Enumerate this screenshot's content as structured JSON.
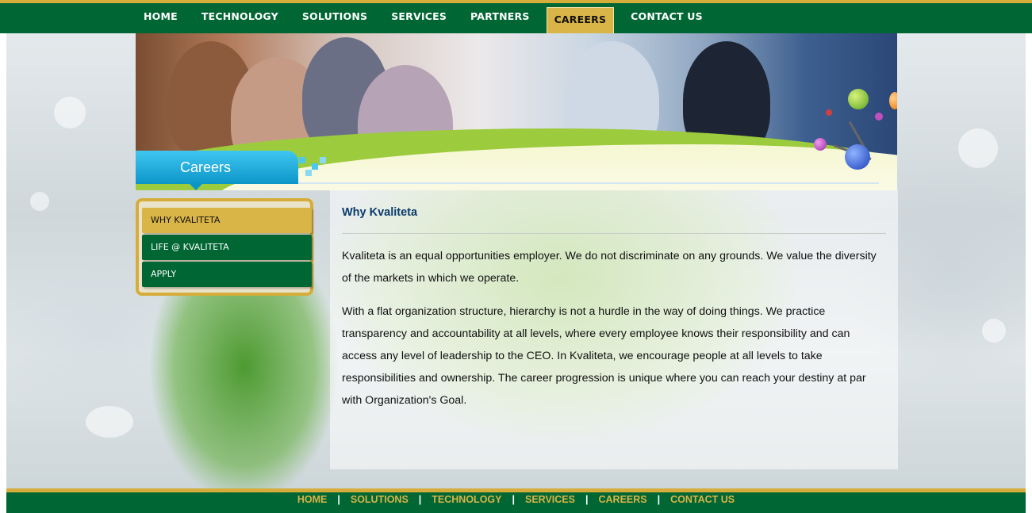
{
  "top_nav": {
    "items": [
      {
        "label": "HOME"
      },
      {
        "label": "TECHNOLOGY"
      },
      {
        "label": "SOLUTIONS"
      },
      {
        "label": "SERVICES"
      },
      {
        "label": "PARTNERS"
      },
      {
        "label": "CAREERS",
        "active": true
      },
      {
        "label": "CONTACT US"
      }
    ]
  },
  "banner": {
    "section_title": "Careers"
  },
  "sidebar": {
    "items": [
      {
        "label": "WHY KVALITETA",
        "active": true
      },
      {
        "label": "LIFE @ KVALITETA"
      },
      {
        "label": "APPLY"
      }
    ]
  },
  "content": {
    "heading": "Why Kvaliteta",
    "paragraphs": [
      "Kvaliteta is an equal opportunities employer. We do not discriminate on any grounds. We value the diversity of the markets in which we operate.",
      "With a flat organization structure, hierarchy is not a hurdle in the way of doing things. We practice transparency and accountability at all levels, where every employee knows their responsibility and can access any level of leadership to the CEO. In Kvaliteta, we encourage people at all levels to take responsibilities and ownership. The career progression is unique where you can reach your destiny at par with Organization's Goal."
    ]
  },
  "footer_nav": {
    "items": [
      {
        "label": "HOME"
      },
      {
        "label": "SOLUTIONS"
      },
      {
        "label": "TECHNOLOGY"
      },
      {
        "label": "SERVICES"
      },
      {
        "label": "CAREERS"
      },
      {
        "label": "CONTACT US"
      }
    ],
    "separator": "|"
  },
  "colors": {
    "brand_green": "#006633",
    "brand_gold": "#d6ad3a",
    "heading_blue": "#0b3a6b",
    "banner_tab_blue": "#0c95c9"
  }
}
